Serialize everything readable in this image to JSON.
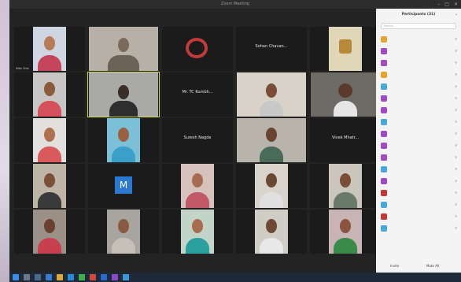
{
  "window": {
    "title": "Zoom Meeting"
  },
  "tiles": [
    {
      "name": "Nitin Shiv",
      "label": ""
    },
    {
      "name": "",
      "label": ""
    },
    {
      "name": "",
      "label": ""
    },
    {
      "name": "",
      "label": "Sohan Chavan..."
    },
    {
      "name": "",
      "label": ""
    },
    {
      "name": "",
      "label": ""
    },
    {
      "name": "",
      "label": ""
    },
    {
      "name": "",
      "label": "Mr. TC Kumbh..."
    },
    {
      "name": "",
      "label": ""
    },
    {
      "name": "",
      "label": ""
    },
    {
      "name": "",
      "label": ""
    },
    {
      "name": "",
      "label": ""
    },
    {
      "name": "",
      "label": "Suresh Nagde"
    },
    {
      "name": "",
      "label": ""
    },
    {
      "name": "",
      "label": "Vivek Mhatr..."
    },
    {
      "name": "",
      "label": ""
    },
    {
      "name": "",
      "label": ""
    },
    {
      "name": "",
      "label": ""
    },
    {
      "name": "",
      "label": ""
    },
    {
      "name": "",
      "label": ""
    },
    {
      "name": "",
      "label": ""
    },
    {
      "name": "",
      "label": ""
    },
    {
      "name": "",
      "label": ""
    },
    {
      "name": "",
      "label": ""
    },
    {
      "name": "",
      "label": ""
    }
  ],
  "panel": {
    "title": "Participants (31)",
    "search_placeholder": "Search",
    "participants": [
      {
        "name": "",
        "color": "#e1a431"
      },
      {
        "name": "",
        "color": "#a04bc4"
      },
      {
        "name": "",
        "color": "#a04bc4"
      },
      {
        "name": "",
        "color": "#e1a431"
      },
      {
        "name": "",
        "color": "#4aa8d8"
      },
      {
        "name": "",
        "color": "#a04bc4"
      },
      {
        "name": "",
        "color": "#a04bc4"
      },
      {
        "name": "",
        "color": "#4aa8d8"
      },
      {
        "name": "",
        "color": "#a04bc4"
      },
      {
        "name": "",
        "color": "#a04bc4"
      },
      {
        "name": "",
        "color": "#a04bc4"
      },
      {
        "name": "",
        "color": "#4aa8d8"
      },
      {
        "name": "",
        "color": "#a04bc4"
      },
      {
        "name": "",
        "color": "#c43a3a"
      },
      {
        "name": "",
        "color": "#4aa8d8"
      },
      {
        "name": "",
        "color": "#c43a3a"
      },
      {
        "name": "",
        "color": "#4aa8d8"
      }
    ],
    "footer_left": "Invite",
    "footer_right": "Mute All"
  },
  "taskbar": {
    "time": ""
  },
  "colors": {
    "screen_bg": "#232323",
    "panel_bg": "#f4f4f4",
    "active_border": "#c8d64a"
  }
}
